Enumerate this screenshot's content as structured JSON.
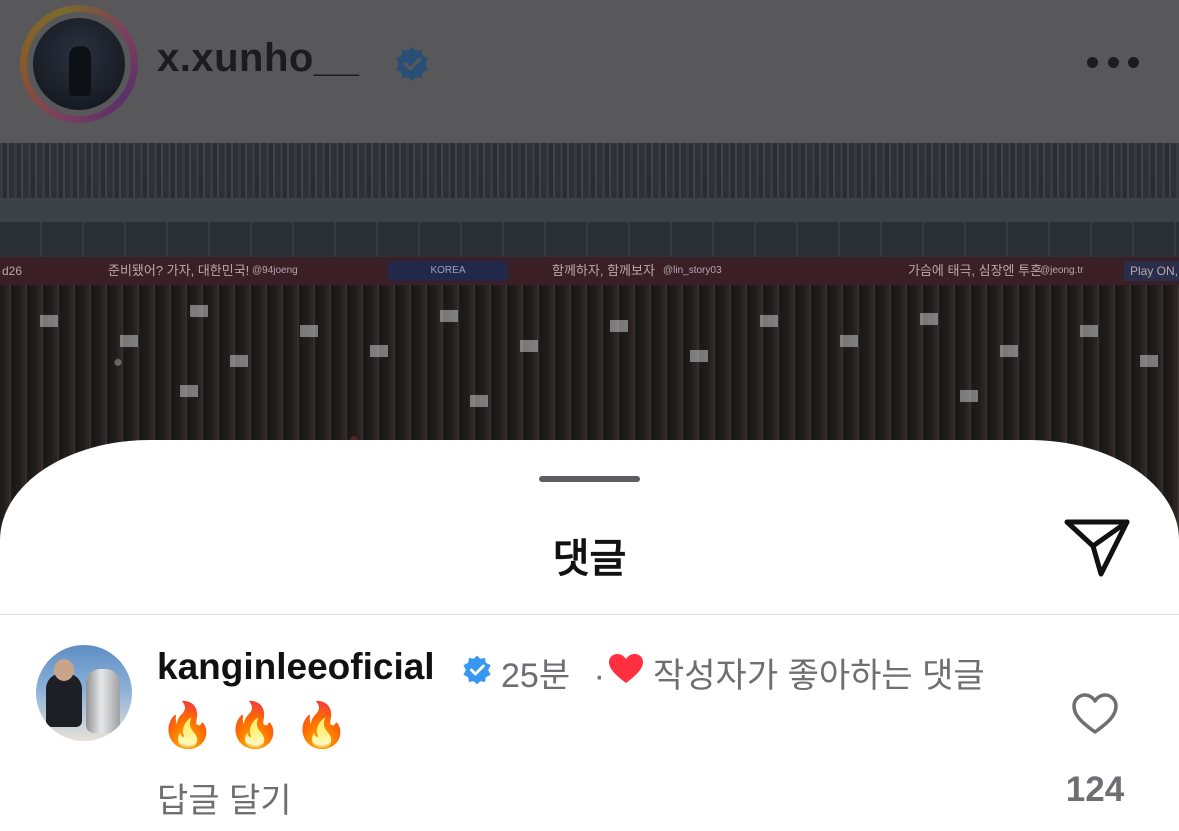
{
  "post": {
    "username": "x.xunho__",
    "verified": true,
    "more_icon": "more-horizontal-icon",
    "banner_texts": [
      "준비됐어? 가자, 대한민국!",
      "@94joeng",
      "KOREA",
      "함께하자, 함께보자",
      "@lin_story03",
      "가슴에 태극, 심장엔 투혼",
      "@jeong.tr",
      "Play ON,"
    ]
  },
  "sheet": {
    "title": "댓글",
    "send_icon": "send-icon"
  },
  "comments": [
    {
      "username": "kanginleeoficial",
      "verified": true,
      "time": "25분",
      "separator": "·",
      "creator_liked_label": "작성자가 좋아하는 댓글",
      "text": "🔥 🔥 🔥",
      "reply_label": "답글 달기",
      "like_count": "124"
    }
  ],
  "colors": {
    "verified_blue": "#3897f0",
    "heart_red": "#ff2f40",
    "muted_text": "#6e6e73"
  }
}
